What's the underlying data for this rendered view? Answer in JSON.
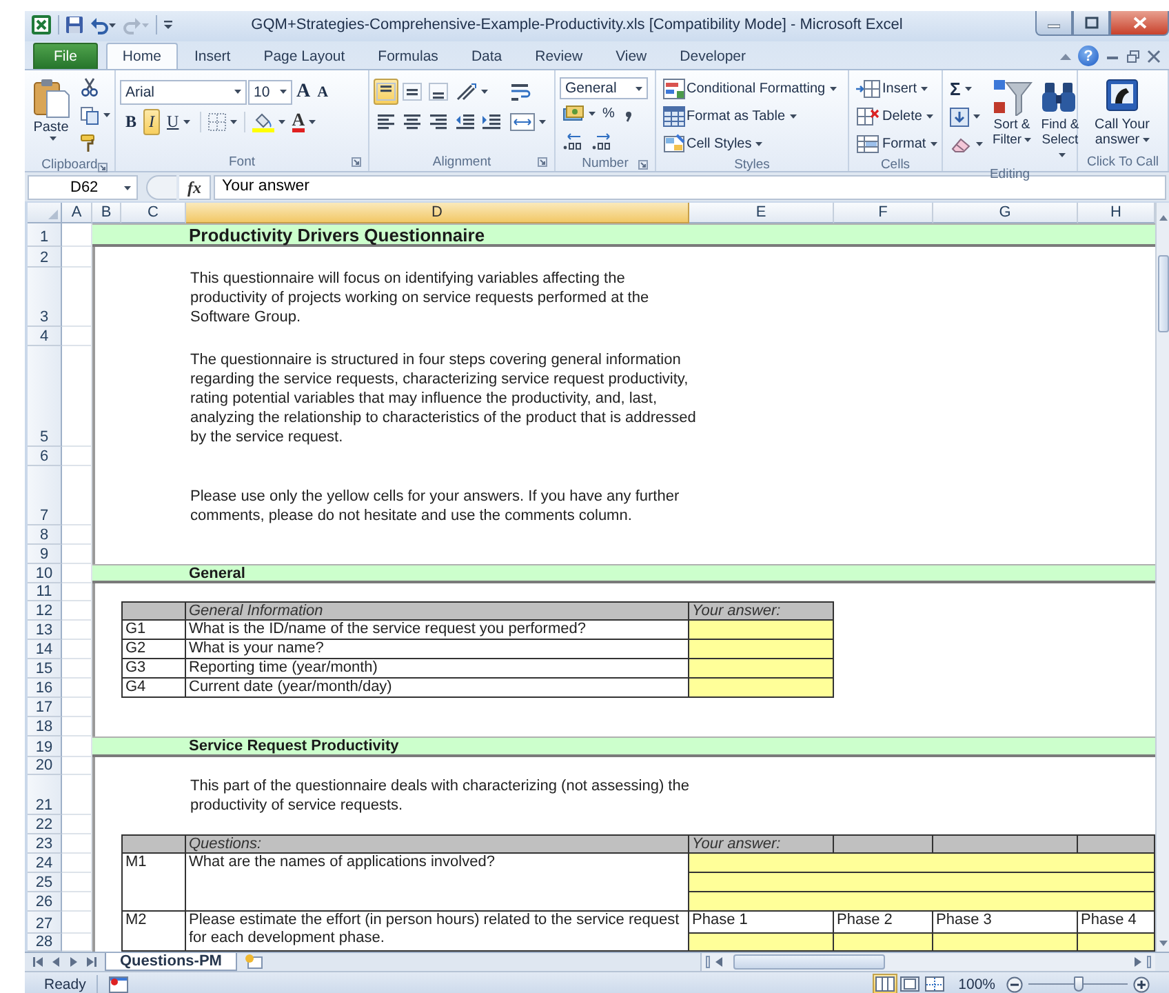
{
  "window": {
    "title": "GQM+Strategies-Comprehensive-Example-Productivity.xls [Compatibility Mode] - Microsoft Excel"
  },
  "ribbon_tabs": [
    {
      "label": "File",
      "kind": "file",
      "selected": false
    },
    {
      "label": "Home",
      "kind": "tab",
      "selected": true
    },
    {
      "label": "Insert",
      "kind": "tab",
      "selected": false
    },
    {
      "label": "Page Layout",
      "kind": "tab",
      "selected": false
    },
    {
      "label": "Formulas",
      "kind": "tab",
      "selected": false
    },
    {
      "label": "Data",
      "kind": "tab",
      "selected": false
    },
    {
      "label": "Review",
      "kind": "tab",
      "selected": false
    },
    {
      "label": "View",
      "kind": "tab",
      "selected": false
    },
    {
      "label": "Developer",
      "kind": "tab",
      "selected": false
    }
  ],
  "help": "?",
  "ribbon": {
    "groups": [
      {
        "kind": "clipboard",
        "label": "Clipboard",
        "paste": "Paste"
      },
      {
        "kind": "font",
        "label": "Font",
        "font": "Arial",
        "size": "10",
        "grow": "A",
        "shrink": "A",
        "buttons": [
          {
            "text": "B",
            "on": false
          },
          {
            "text": "I",
            "on": true
          },
          {
            "text": "U",
            "on": false
          }
        ],
        "font_color": "A"
      },
      {
        "kind": "alignment",
        "label": "Alignment",
        "top_align_on": true
      },
      {
        "kind": "number",
        "label": "Number",
        "format": "General",
        "percent": "%"
      },
      {
        "kind": "styles",
        "label": "Styles",
        "items": [
          "Conditional Formatting",
          "Format as Table",
          "Cell Styles"
        ]
      },
      {
        "kind": "cells",
        "label": "Cells",
        "items": [
          "Insert",
          "Delete",
          "Format"
        ]
      },
      {
        "kind": "editing",
        "label": "Editing",
        "sum": "Σ",
        "sort": "Sort & Filter",
        "find": "Find & Select"
      },
      {
        "kind": "call",
        "label": "Click To Call",
        "button": "Call Your answer"
      }
    ]
  },
  "formula_bar": {
    "name_box": "D62",
    "function_label": "fx",
    "value": "Your answer"
  },
  "sheet": {
    "columns": [
      {
        "label": "A",
        "selected": false
      },
      {
        "label": "B",
        "selected": false
      },
      {
        "label": "C",
        "selected": false
      },
      {
        "label": "D",
        "selected": true
      },
      {
        "label": "E",
        "selected": false
      },
      {
        "label": "F",
        "selected": false
      },
      {
        "label": "G",
        "selected": false
      },
      {
        "label": "H",
        "selected": false
      }
    ],
    "row_numbers": [
      "1",
      "2",
      "3",
      "4",
      "5",
      "6",
      "7",
      "8",
      "9",
      "10",
      "11",
      "12",
      "13",
      "14",
      "15",
      "16",
      "17",
      "18",
      "19",
      "20",
      "21",
      "22",
      "23",
      "24",
      "25",
      "26",
      "27",
      "28"
    ],
    "content": [
      {
        "kind": "title",
        "text": "Productivity Drivers Questionnaire"
      },
      {
        "kind": "blank"
      },
      {
        "kind": "text",
        "text": "This questionnaire will focus on identifying variables affecting the productivity of projects working on service requests performed at the Software Group."
      },
      {
        "kind": "blank"
      },
      {
        "kind": "text",
        "text": "The questionnaire is structured in four steps covering general information regarding the service requests, characterizing service request productivity, rating potential variables that may influence the productivity, and, last, analyzing the relationship to characteristics of the product that is addressed by the service request."
      },
      {
        "kind": "blank"
      },
      {
        "kind": "text",
        "text": "Please use only the yellow cells for your answers. If you have any further comments, please do not hesitate and use the comments column."
      },
      {
        "kind": "blank"
      },
      {
        "kind": "blank"
      },
      {
        "kind": "section",
        "text": "General"
      },
      {
        "kind": "blank"
      },
      {
        "kind": "narrow-table",
        "header": {
          "question": "General Information",
          "answer": "Your answer:"
        },
        "rows": [
          {
            "id": "G1",
            "question": "What is the ID/name of the service request you performed?",
            "answers": [
              {
                "kind": "cell"
              }
            ]
          },
          {
            "id": "G2",
            "question": "What is your name?",
            "answers": [
              {
                "kind": "cell"
              }
            ]
          },
          {
            "id": "G3",
            "question": "Reporting time (year/month)",
            "answers": [
              {
                "kind": "cell"
              }
            ]
          },
          {
            "id": "G4",
            "question": "Current date (year/month/day)",
            "answers": [
              {
                "kind": "cell"
              }
            ]
          }
        ]
      },
      {
        "kind": "blank"
      },
      {
        "kind": "blank"
      },
      {
        "kind": "section",
        "text": "Service Request Productivity"
      },
      {
        "kind": "blank"
      },
      {
        "kind": "text",
        "text": "This part of the questionnaire deals with characterizing (not assessing) the productivity of service requests."
      },
      {
        "kind": "blank"
      },
      {
        "kind": "wide-table",
        "header": {
          "question": "Questions:",
          "answer": "Your answer:"
        },
        "rows": [
          {
            "id": "M1",
            "question": "What are the names of applications involved?",
            "answers": [
              {
                "kind": "line"
              },
              {
                "kind": "line"
              },
              {
                "kind": "line"
              }
            ]
          },
          {
            "id": "M2",
            "question": "Please estimate the effort (in person hours) related to the service request for each development phase.",
            "answers": [
              {
                "kind": "phases",
                "phases": [
                  "Phase 1",
                  "Phase 2",
                  "Phase 3",
                  "Phase 4"
                ]
              }
            ]
          }
        ]
      }
    ]
  },
  "sheet_tabs": [
    {
      "label": "Questions-PM",
      "selected": true
    }
  ],
  "status_bar": {
    "text": "Ready",
    "views": [
      {
        "kind": "normal",
        "selected": true
      },
      {
        "kind": "page-layout",
        "selected": false
      },
      {
        "kind": "page-break",
        "selected": false
      }
    ],
    "zoom": "100%",
    "zoom_slider": {
      "level": 0.5
    }
  }
}
